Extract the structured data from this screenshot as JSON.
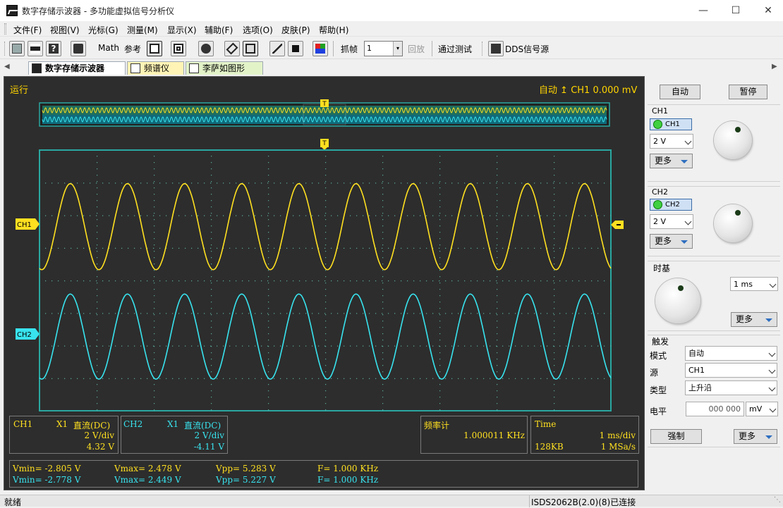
{
  "window": {
    "title": "数字存储示波器 - 多功能虚拟信号分析仪"
  },
  "menu": [
    "文件(F)",
    "视图(V)",
    "光标(G)",
    "测量(M)",
    "显示(X)",
    "辅助(F)",
    "选项(O)",
    "皮肤(P)",
    "帮助(H)"
  ],
  "toolbar": {
    "math": "Math",
    "ref": "参考",
    "capture": "抓帧",
    "frame_value": "1",
    "playback": "回放",
    "pass_test": "通过测试",
    "dds": "DDS信号源"
  },
  "tabs": [
    "数字存储示波器",
    "频谱仪",
    "李萨如图形"
  ],
  "scope": {
    "status": "运行",
    "trigger_mode": "自动",
    "trigger_info": "CH1 0.000 mV",
    "trigger_marker": "T",
    "ch1_marker": "CH1",
    "ch2_marker": "CH2",
    "ch1": {
      "amplitude": 2.64,
      "offset": -0.16,
      "frequency_khz": 1.0,
      "color": "#ffe020"
    },
    "ch2": {
      "amplitude": 2.61,
      "offset": -0.16,
      "frequency_khz": 1.0,
      "color": "#38e3ee"
    },
    "timebase_ms_per_div": 1,
    "volts_per_div": 2
  },
  "ch1_info": {
    "name": "CH1",
    "probe": "X1",
    "coupling": "直流(DC)",
    "scale": "2 V/div",
    "offset": "4.32 V"
  },
  "ch2_info": {
    "name": "CH2",
    "probe": "X1",
    "coupling": "直流(DC)",
    "scale": "2 V/div",
    "offset": "-4.11 V"
  },
  "freq_counter": {
    "label": "频率计",
    "value": "1.000011 KHz"
  },
  "time_info": {
    "label": "Time",
    "scale": "1 ms/div",
    "depth": "128KB",
    "rate": "1 MSa/s"
  },
  "measure": {
    "ch1": {
      "vmin": "Vmin= -2.805 V",
      "vmax": "Vmax= 2.478 V",
      "vpp": "Vpp= 5.283 V",
      "f": "F= 1.000 KHz"
    },
    "ch2": {
      "vmin": "Vmin= -2.778 V",
      "vmax": "Vmax= 2.449 V",
      "vpp": "Vpp= 5.227 V",
      "f": "F= 1.000 KHz"
    }
  },
  "panel": {
    "auto": "自动",
    "pause": "暂停",
    "ch1_group": "CH1",
    "ch1_btn": "CH1",
    "ch1_scale": "2 V",
    "more": "更多",
    "ch2_group": "CH2",
    "ch2_btn": "CH2",
    "ch2_scale": "2 V",
    "timebase_group": "时基",
    "timebase": "1 ms",
    "trigger_group": "触发",
    "mode_label": "模式",
    "mode": "自动",
    "source_label": "源",
    "source": "CH1",
    "type_label": "类型",
    "type": "上升沿",
    "level_label": "电平",
    "level": "000 000",
    "level_unit": "mV",
    "force": "强制"
  },
  "status": {
    "left": "就绪",
    "right": "ISDS2062B(2.0)(8)已连接"
  }
}
